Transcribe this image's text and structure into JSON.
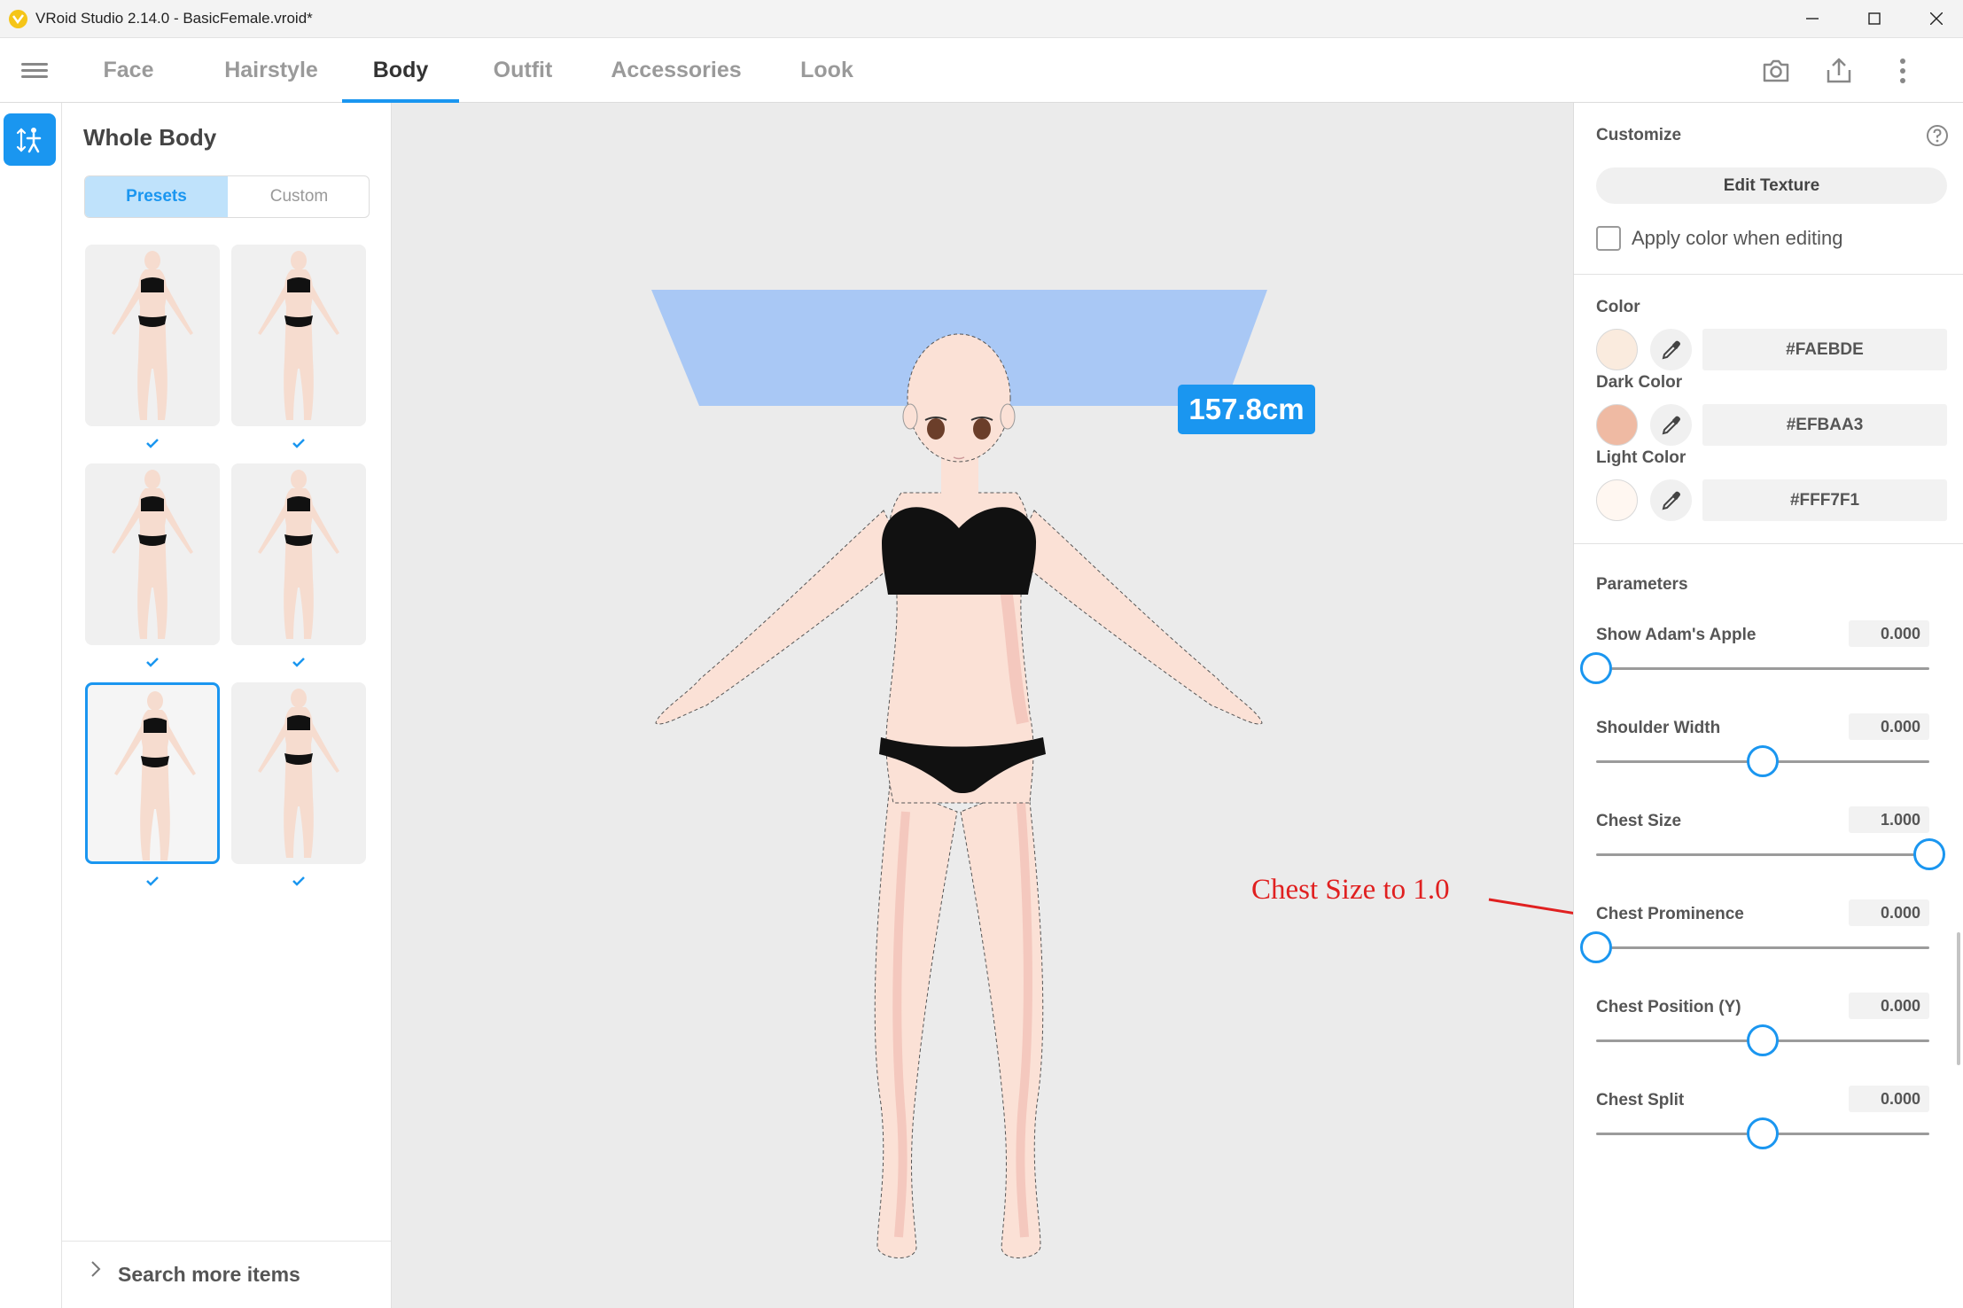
{
  "window": {
    "title": "VRoid Studio 2.14.0 - BasicFemale.vroid*",
    "controls": [
      "minimize",
      "maximize",
      "close"
    ]
  },
  "tabs": [
    {
      "label": "Face",
      "active": false
    },
    {
      "label": "Hairstyle",
      "active": false
    },
    {
      "label": "Body",
      "active": true
    },
    {
      "label": "Outfit",
      "active": false
    },
    {
      "label": "Accessories",
      "active": false
    },
    {
      "label": "Look",
      "active": false
    }
  ],
  "toolbar_icons": [
    "camera-icon",
    "export-icon",
    "more-vertical-icon"
  ],
  "left_panel": {
    "title": "Whole Body",
    "segments": {
      "presets": "Presets",
      "custom": "Custom",
      "active": "presets"
    },
    "presets": [
      {
        "checked": true,
        "selected": false
      },
      {
        "checked": true,
        "selected": false
      },
      {
        "checked": true,
        "selected": false
      },
      {
        "checked": true,
        "selected": false
      },
      {
        "checked": true,
        "selected": true
      },
      {
        "checked": true,
        "selected": false
      }
    ],
    "search_more": "Search more items"
  },
  "viewport": {
    "height_label": "157.8cm",
    "annotation": "Chest Size to 1.0"
  },
  "right_panel": {
    "customize": {
      "title": "Customize",
      "edit_texture": "Edit Texture",
      "apply_color_label": "Apply color when editing",
      "apply_color_checked": false
    },
    "colors": [
      {
        "label": "Color",
        "hex": "#FAEBDE"
      },
      {
        "label": "Dark Color",
        "hex": "#EFBAA3"
      },
      {
        "label": "Light Color",
        "hex": "#FFF7F1"
      }
    ],
    "parameters": {
      "title": "Parameters",
      "items": [
        {
          "label": "Show Adam's Apple",
          "value": "0.000",
          "position": 0.0
        },
        {
          "label": "Shoulder Width",
          "value": "0.000",
          "position": 0.5
        },
        {
          "label": "Chest Size",
          "value": "1.000",
          "position": 1.0
        },
        {
          "label": "Chest Prominence",
          "value": "0.000",
          "position": 0.0
        },
        {
          "label": "Chest Position (Y)",
          "value": "0.000",
          "position": 0.5
        },
        {
          "label": "Chest Split",
          "value": "0.000",
          "position": 0.5
        }
      ]
    }
  },
  "colors": {
    "accent": "#1A96F0",
    "annotation": "#E02020",
    "height_box": "#A9C8F5"
  }
}
